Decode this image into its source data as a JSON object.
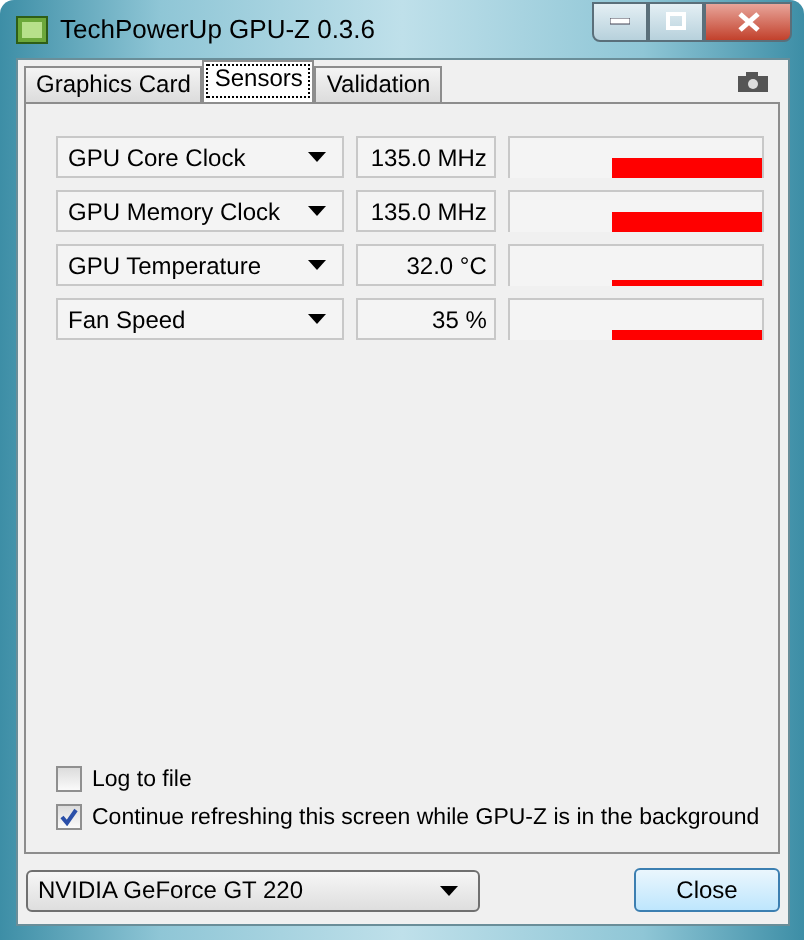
{
  "window": {
    "title": "TechPowerUp GPU-Z 0.3.6"
  },
  "tabs": [
    {
      "label": "Graphics Card",
      "selected": false
    },
    {
      "label": "Sensors",
      "selected": true
    },
    {
      "label": "Validation",
      "selected": false
    }
  ],
  "sensors": [
    {
      "name": "GPU Core Clock",
      "reading": "135.0 MHz"
    },
    {
      "name": "GPU Memory Clock",
      "reading": "135.0 MHz"
    },
    {
      "name": "GPU Temperature",
      "reading": "32.0 °C"
    },
    {
      "name": "Fan Speed",
      "reading": "35 %"
    }
  ],
  "options": [
    {
      "label": "Log to file",
      "checked": false
    },
    {
      "label": "Continue refreshing this screen while GPU-Z is in the background",
      "checked": true
    }
  ],
  "card_select": {
    "value": "NVIDIA GeForce GT 220"
  },
  "buttons": [
    {
      "label": "Close"
    }
  ]
}
